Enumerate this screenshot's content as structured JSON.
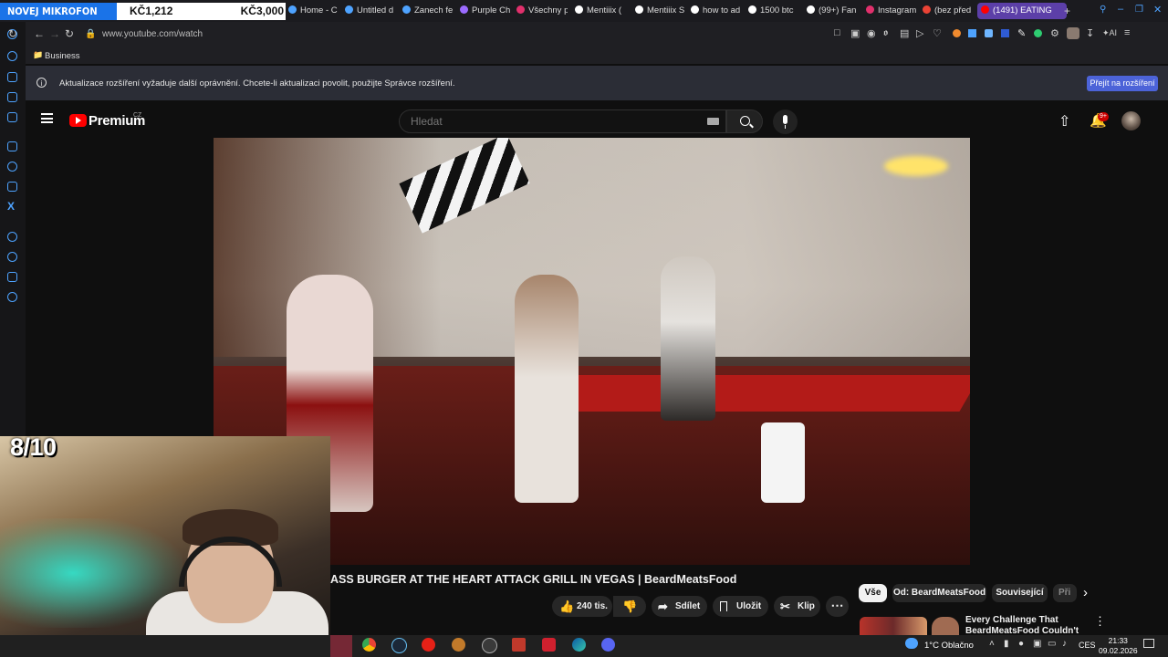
{
  "donation_bar": {
    "label": "NOVEJ MIKROFON",
    "current": "KČ1,212",
    "goal": "KČ3,000",
    "progress": 0.404
  },
  "tabs": [
    {
      "label": "Home - C",
      "color": "#4ea3ff"
    },
    {
      "label": "Untitled d",
      "color": "#4ea3ff"
    },
    {
      "label": "Zanech fe",
      "color": "#4ea3ff"
    },
    {
      "label": "Purple Ch",
      "color": "#9b6bff"
    },
    {
      "label": "Všechny p",
      "color": "#e1306c"
    },
    {
      "label": "Mentiiix (",
      "color": "#ffffff"
    },
    {
      "label": "Mentiiix S",
      "color": "#ffffff"
    },
    {
      "label": "how to ad",
      "color": "#ffffff"
    },
    {
      "label": "1500 btc",
      "color": "#ffffff"
    },
    {
      "label": "(99+) Fan",
      "color": "#ffffff"
    },
    {
      "label": "Instagram",
      "color": "#e1306c"
    },
    {
      "label": "(bez před",
      "color": "#ea4335"
    },
    {
      "label": "(1491) EATING",
      "color": "#ff0000"
    }
  ],
  "address_bar": {
    "url": "www.youtube.com/watch"
  },
  "bookmarks": [
    {
      "label": "Business"
    }
  ],
  "notice": {
    "text": "Aktualizace rozšíření vyžaduje další oprávnění. Chcete-li aktualizaci povolit, použijte Správce rozšíření.",
    "button": "Přejít na rozšíření"
  },
  "youtube": {
    "logo": "Premium",
    "region": "CZ",
    "search_placeholder": "Hledat",
    "notification_badge": "9+"
  },
  "overlay": {
    "rating": "8/10"
  },
  "video": {
    "title": "ASS BURGER AT THE HEART ATTACK GRILL IN VEGAS | BeardMeatsFood",
    "likes": "240 tis.",
    "share": "Sdílet",
    "save": "Uložit",
    "clip": "Klip"
  },
  "chips": [
    "Vše",
    "Od: BeardMeatsFood",
    "Související",
    "Při"
  ],
  "related": {
    "title": "Every Challenge That BeardMeatsFood Couldn't Beat"
  },
  "taskbar": {
    "weather": "1°C  Oblačno",
    "language": "CES",
    "time": "21:33",
    "date": "09.02.2026"
  },
  "accent_colors": {
    "youtube_red": "#ff0000",
    "notice_button": "#4c63d8",
    "donation_blue": "#1a73e8",
    "active_tab": "#5c3fa8"
  }
}
